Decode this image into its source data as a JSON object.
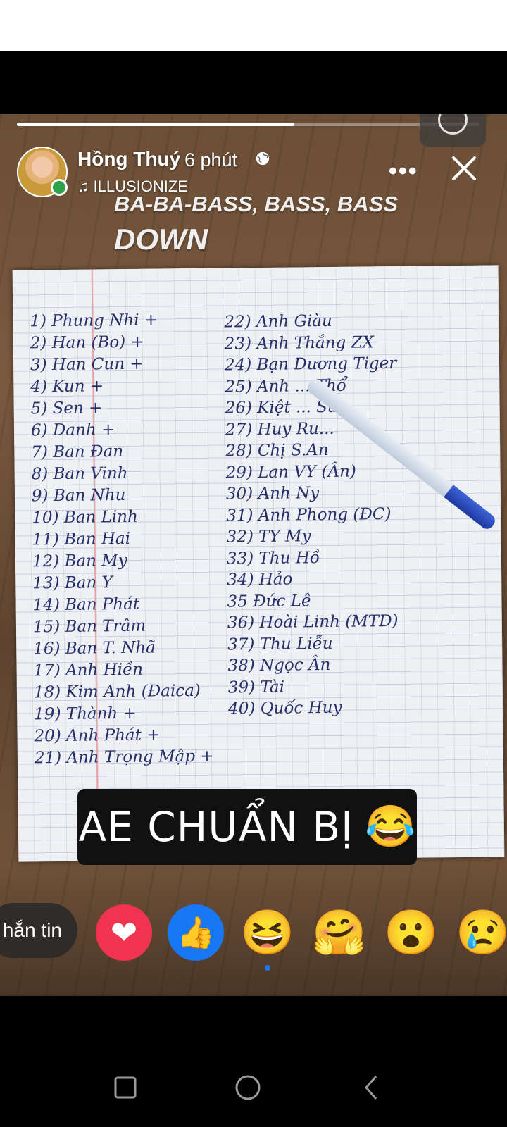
{
  "story": {
    "progress": 0.6,
    "user_name": "Hồng Thuý",
    "time_ago": "6 phút",
    "music": "ILLUSIONIZE",
    "lyrics": [
      "BA-BA-BASS, BASS, BASS",
      "DOWN"
    ],
    "caption": "AE CHUẨN BỊ",
    "caption_emoji": "😂"
  },
  "handwritten_list": {
    "left": [
      "1) Phung Nhi +",
      "2) Han (Bo) +",
      "3) Han Cun +",
      "4) Kun +",
      "5) Sen +",
      "6) Danh +",
      "7) Ban Đan",
      "8) Ban Vinh",
      "9) Ban Nhu",
      "10) Ban Linh",
      "11) Ban Hai",
      "12) Ban My",
      "13) Ban Y",
      "14) Ban Phát",
      "15) Ban Trâm",
      "16) Ban T. Nhã",
      "17) Anh Hiền",
      "18) Kim Anh (Đaica)",
      "19) Thành +",
      "20) Anh Phát +",
      "21) Anh Trọng Mập +"
    ],
    "right": [
      "22) Anh Giàu",
      "23) Anh Thắng ZX",
      "24) Bạn Dương Tiger",
      "25) Anh ... Thổ",
      "26) Kiệt ... Sư",
      "27) Huy Ru...",
      "28) Chị S.An",
      "29) Lan VY (Ân)",
      "30) Anh Ny",
      "31) Anh Phong (ĐC)",
      "32) TY My",
      "33) Thu Hồ",
      "34) Hảo",
      "35 Đức Lê",
      "36) Hoài Linh (MTD)",
      "37) Thu Liễu",
      "38) Ngọc Ân",
      "39) Tài",
      "40) Quốc Huy"
    ]
  },
  "reply_label": "hắn tin",
  "reactions": [
    {
      "name": "love",
      "glyph": "❤"
    },
    {
      "name": "like",
      "glyph": "👍"
    },
    {
      "name": "haha",
      "glyph": "😆"
    },
    {
      "name": "care",
      "glyph": "🤗"
    },
    {
      "name": "wow",
      "glyph": "😮"
    },
    {
      "name": "sad",
      "glyph": "😢"
    }
  ]
}
